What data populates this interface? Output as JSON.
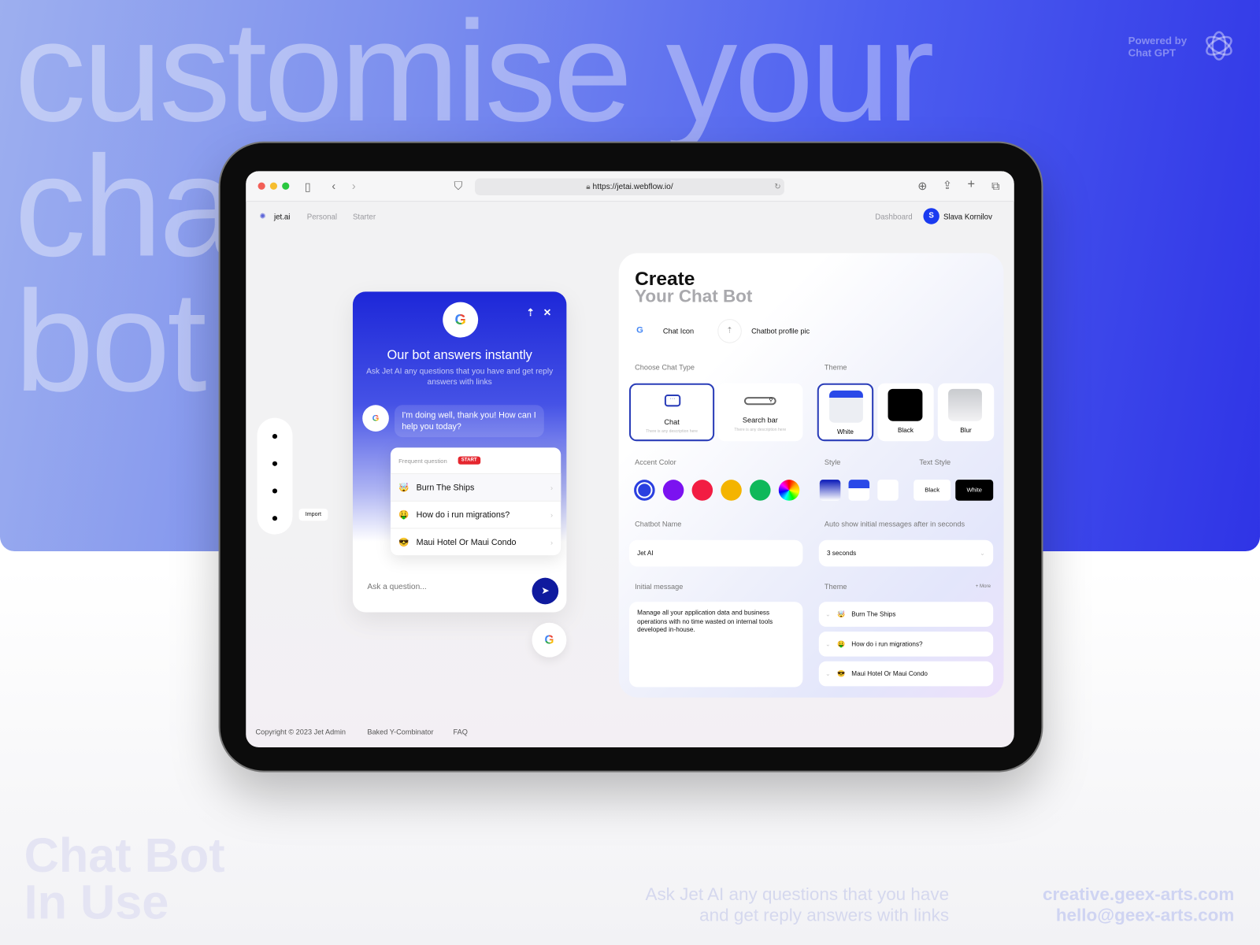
{
  "hero": {
    "headline_lines": [
      "customise your",
      "chat",
      "bot"
    ],
    "powered_by": [
      "Powered by",
      "Chat GPT"
    ],
    "logo_icon": "openai-icon"
  },
  "browser": {
    "url": "https://jetai.webflow.io/",
    "icons": [
      "sidebar-icon",
      "back-icon",
      "forward-icon",
      "shield-icon",
      "lock-icon",
      "reload-icon",
      "download-icon",
      "share-icon",
      "plus-icon",
      "tabs-icon"
    ]
  },
  "nav": {
    "brand": "jet.ai",
    "items": [
      "Personal",
      "Starter"
    ],
    "dashboard": "Dashboard",
    "user_initial": "S",
    "user_name": "Slava Kornilov"
  },
  "rail": {
    "tooltip": "Import"
  },
  "widget": {
    "title": "Our bot answers instantly",
    "subtitle": "Ask Jet AI any questions that you have and get reply answers with links",
    "bot_message": "I'm doing well, thank you! How can I help you today?",
    "faq_label": "Frequent question",
    "faq_badge": "START",
    "questions": [
      {
        "emoji": "🤯",
        "text": "Burn The Ships"
      },
      {
        "emoji": "🤑",
        "text": "How do i run migrations?"
      },
      {
        "emoji": "😎",
        "text": "Maui Hotel Or Maui Condo"
      }
    ],
    "input_placeholder": "Ask a question..."
  },
  "panel": {
    "title": "Create",
    "subtitle": "Your Chat Bot",
    "chat_icon_label": "Chat Icon",
    "profile_pic_label": "Chatbot profile pic",
    "chat_type_label": "Choose Chat Type",
    "chat_types": [
      {
        "name": "Chat",
        "desc": "There is any description here",
        "selected": true
      },
      {
        "name": "Search bar",
        "desc": "There is any description here",
        "selected": false
      }
    ],
    "theme_label": "Theme",
    "themes": [
      {
        "name": "White",
        "selected": true
      },
      {
        "name": "Black",
        "selected": false
      },
      {
        "name": "Blur",
        "selected": false
      }
    ],
    "accent_label": "Accent Color",
    "accent_colors": [
      "#2a3fe0",
      "#7b12f0",
      "#f21d43",
      "#f4b400",
      "#0fb85a",
      "rainbow"
    ],
    "accent_selected": "#2a3fe0",
    "style_label": "Style",
    "text_style_label": "Text Style",
    "text_styles": [
      "Black",
      "White"
    ],
    "text_style_selected": "White",
    "name_label": "Chatbot Name",
    "name_value": "Jet AI",
    "auto_label": "Auto show initial messages after in seconds",
    "auto_value": "3 seconds",
    "initial_label": "Initial message",
    "initial_value": "Manage all your application data and business operations with no time wasted on internal tools developed in-house.",
    "theme2_label": "Theme",
    "more": "+ More",
    "theme_items": [
      {
        "emoji": "🤯",
        "text": "Burn The Ships"
      },
      {
        "emoji": "🤑",
        "text": "How do i run migrations?"
      },
      {
        "emoji": "😎",
        "text": "Maui Hotel Or Maui Condo"
      }
    ]
  },
  "footer": {
    "copyright": "Copyright © 2023 Jet Admin",
    "baked": "Baked Y-Combinator",
    "faq": "FAQ"
  },
  "bottom": {
    "title_lines": [
      "Chat Bot",
      "In Use"
    ],
    "tagline_lines": [
      "Ask Jet AI any questions that you have",
      "and get reply answers with links"
    ],
    "contacts": [
      "creative.geex-arts.com",
      "hello@geex-arts.com"
    ]
  }
}
